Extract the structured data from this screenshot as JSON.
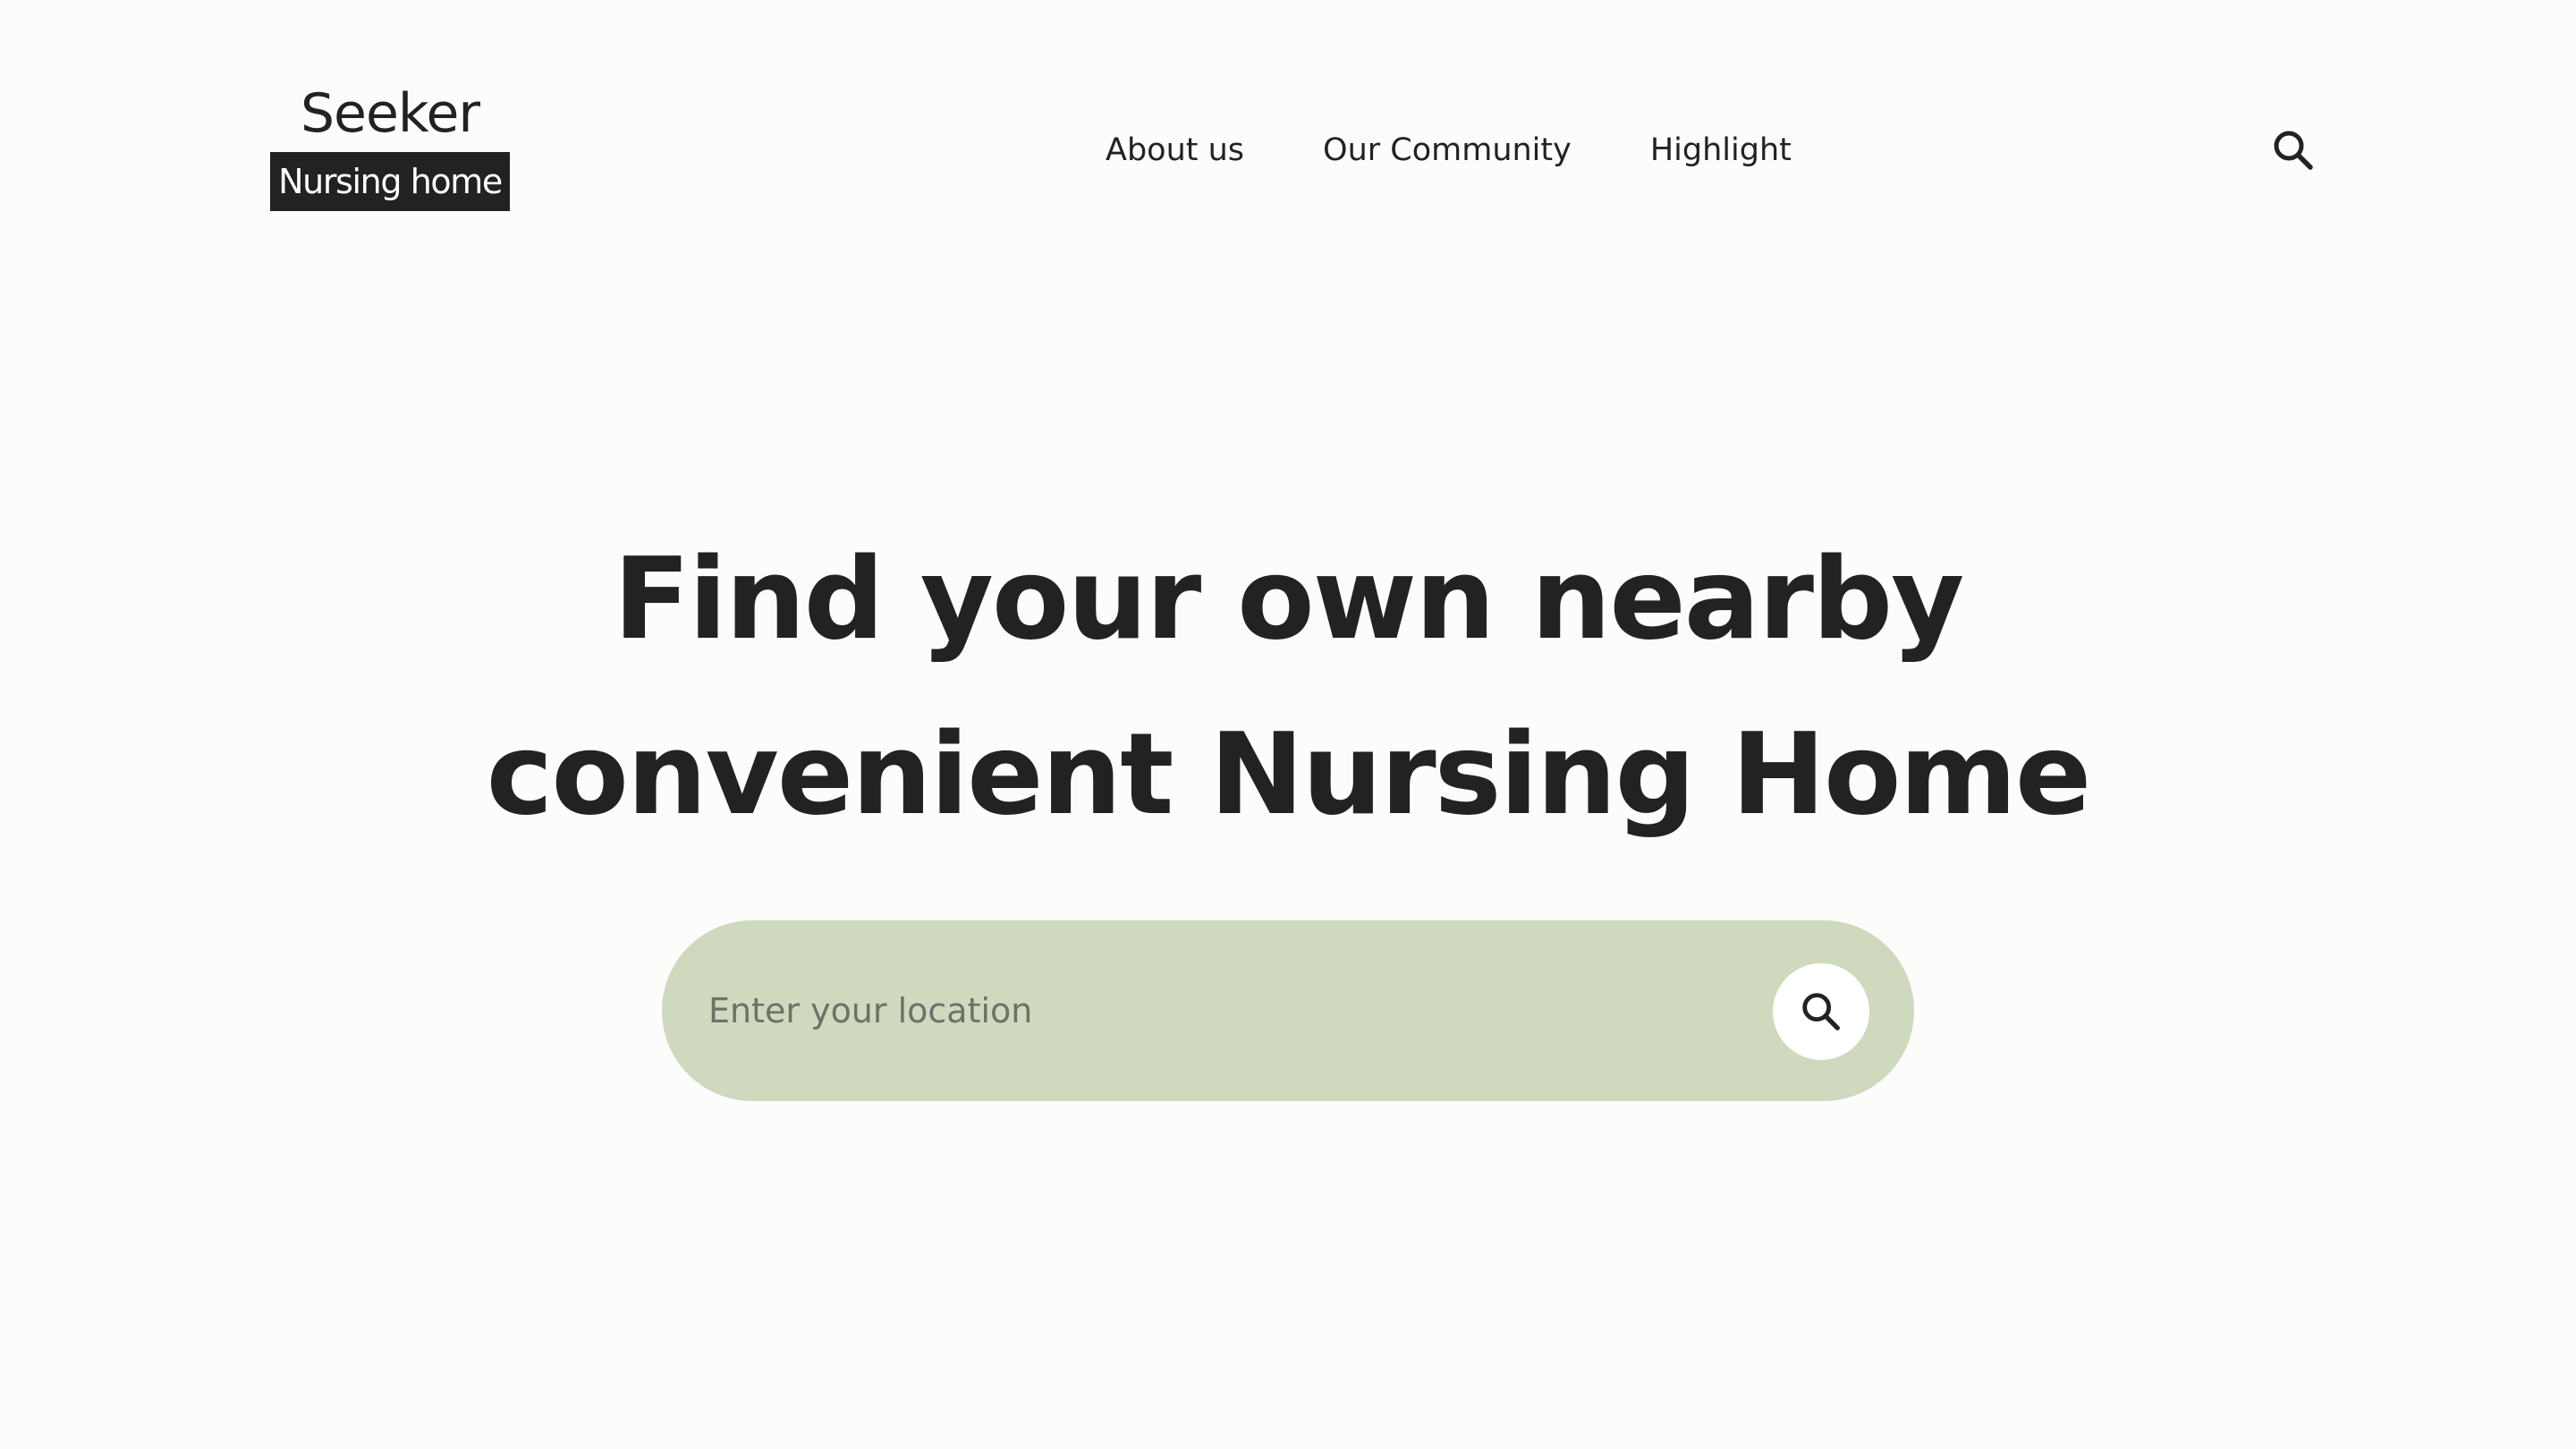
{
  "brand": {
    "name": "Seeker",
    "tagline": "Nursing home"
  },
  "nav": {
    "items": [
      {
        "label": "About us"
      },
      {
        "label": "Our Community"
      },
      {
        "label": "Highlight"
      }
    ],
    "search_icon": "search-icon"
  },
  "hero": {
    "title_line1": "Find your own nearby",
    "title_line2": "convenient Nursing Home"
  },
  "search": {
    "placeholder": "Enter your location",
    "value": "",
    "button_icon": "search-icon"
  },
  "colors": {
    "background": "#fcfcfb",
    "text": "#222222",
    "search_bar": "#cfd9be",
    "search_button": "#ffffff",
    "brand_badge": "#222222"
  }
}
